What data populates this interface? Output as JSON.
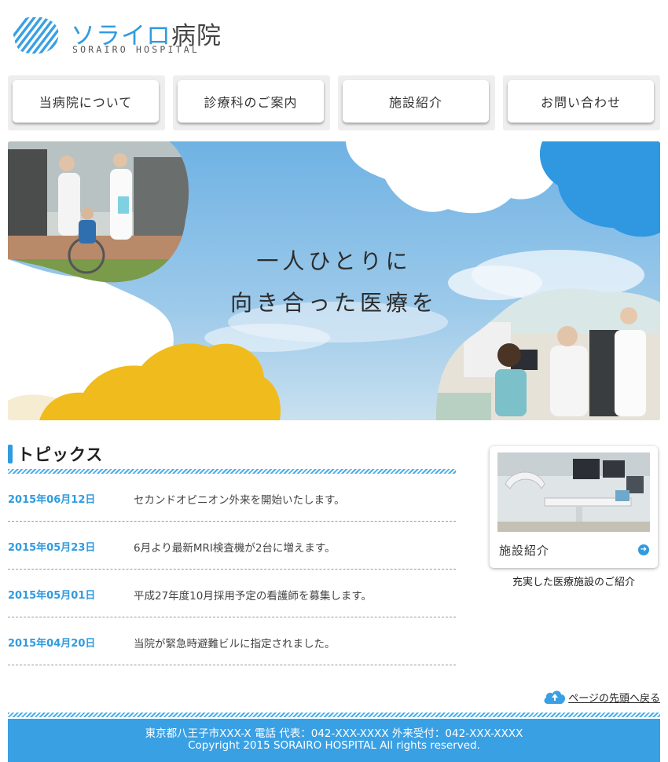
{
  "header": {
    "logo_name": "ソライロ病院",
    "logo_name_kana": "ソライロ",
    "logo_name_kanji": "病院",
    "logo_sub": "SORAIRO HOSPITAL"
  },
  "nav": {
    "items": [
      {
        "label": "当病院について"
      },
      {
        "label": "診療科のご案内"
      },
      {
        "label": "施設紹介"
      },
      {
        "label": "お問い合わせ"
      }
    ]
  },
  "hero": {
    "line1": "一人ひとりに",
    "line2": "向き合った医療を"
  },
  "topics": {
    "title": "トピックス",
    "items": [
      {
        "date": "2015年06月12日",
        "text": "セカンドオピニオン外来を開始いたします。"
      },
      {
        "date": "2015年05月23日",
        "text": "6月より最新MRI検査機が2台に増えます。"
      },
      {
        "date": "2015年05月01日",
        "text": "平成27年度10月採用予定の看護師を募集します。"
      },
      {
        "date": "2015年04月20日",
        "text": "当院が緊急時避難ビルに指定されました。"
      }
    ]
  },
  "side_card": {
    "label": "施設紹介",
    "caption": "充実した医療施設のご紹介"
  },
  "back_to_top": {
    "label": "ページの先頭へ戻る"
  },
  "footer": {
    "address": "東京都八王子市XXX-X 電話 代表：042-XXX-XXXX 外来受付：042-XXX-XXXX",
    "copyright": "Copyright 2015 SORAIRO HOSPITAL All rights reserved."
  },
  "colors": {
    "accent": "#2f9be0",
    "footer_bg": "#3aa0e4",
    "hero_yellow": "#f0bc1d",
    "hero_sky": "#82bde6"
  }
}
